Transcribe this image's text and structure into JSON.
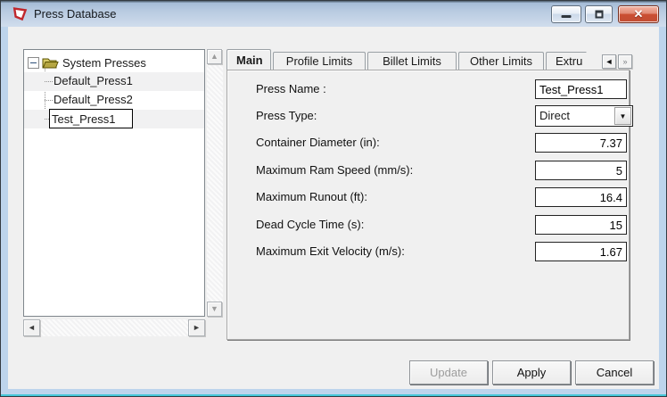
{
  "window": {
    "title": "Press Database",
    "controls": {
      "minimize": "minimize-button",
      "maximize": "maximize-button",
      "close_glyph": "✕"
    }
  },
  "icons": {
    "up_arrow": "▲",
    "down_arrow": "▼",
    "left_arrow": "◄",
    "right_arrow": "►",
    "tab_scroll_left": "◄",
    "tab_scroll_right": "»",
    "combo_arrow": "▼"
  },
  "tree": {
    "root_label": "System Presses",
    "items": [
      {
        "label": "Default_Press1",
        "editing": false
      },
      {
        "label": "Default_Press2",
        "editing": false
      },
      {
        "label": "Test_Press1",
        "editing": true
      }
    ]
  },
  "tabs": [
    {
      "label": "Main",
      "selected": true
    },
    {
      "label": "Profile Limits",
      "selected": false
    },
    {
      "label": "Billet Limits",
      "selected": false
    },
    {
      "label": "Other Limits",
      "selected": false
    },
    {
      "label": "Extru",
      "selected": false,
      "truncated": true
    }
  ],
  "form": {
    "fields": [
      {
        "label": "Press Name :",
        "value": "Test_Press1",
        "type": "text",
        "align": "left"
      },
      {
        "label": "Press Type:",
        "value": "Direct",
        "type": "dropdown",
        "align": "left"
      },
      {
        "label": "Container Diameter (in):",
        "value": "7.37",
        "type": "text",
        "align": "right"
      },
      {
        "label": "Maximum Ram Speed (mm/s):",
        "value": "5",
        "type": "text",
        "align": "right"
      },
      {
        "label": "Maximum Runout (ft):",
        "value": "16.4",
        "type": "text",
        "align": "right"
      },
      {
        "label": "Dead Cycle Time (s):",
        "value": "15",
        "type": "text",
        "align": "right"
      },
      {
        "label": "Maximum Exit Velocity (m/s):",
        "value": "1.67",
        "type": "text",
        "align": "right"
      }
    ]
  },
  "buttons": [
    {
      "label": "Update",
      "enabled": false
    },
    {
      "label": "Apply",
      "enabled": true
    },
    {
      "label": "Cancel",
      "enabled": true
    }
  ],
  "colors": {
    "titlebar_gradient_top": "#a4bbd6",
    "titlebar_gradient_bottom": "#cfdcec",
    "window_border": "#bdd4ec",
    "teal_edge": "#45c7d8",
    "client_bg": "#f0f0f0",
    "close_button_red": "#c24d33",
    "logo_red": "#c0272d",
    "folder_olive": "#b5a642",
    "disabled_text": "#9d9d9d"
  }
}
